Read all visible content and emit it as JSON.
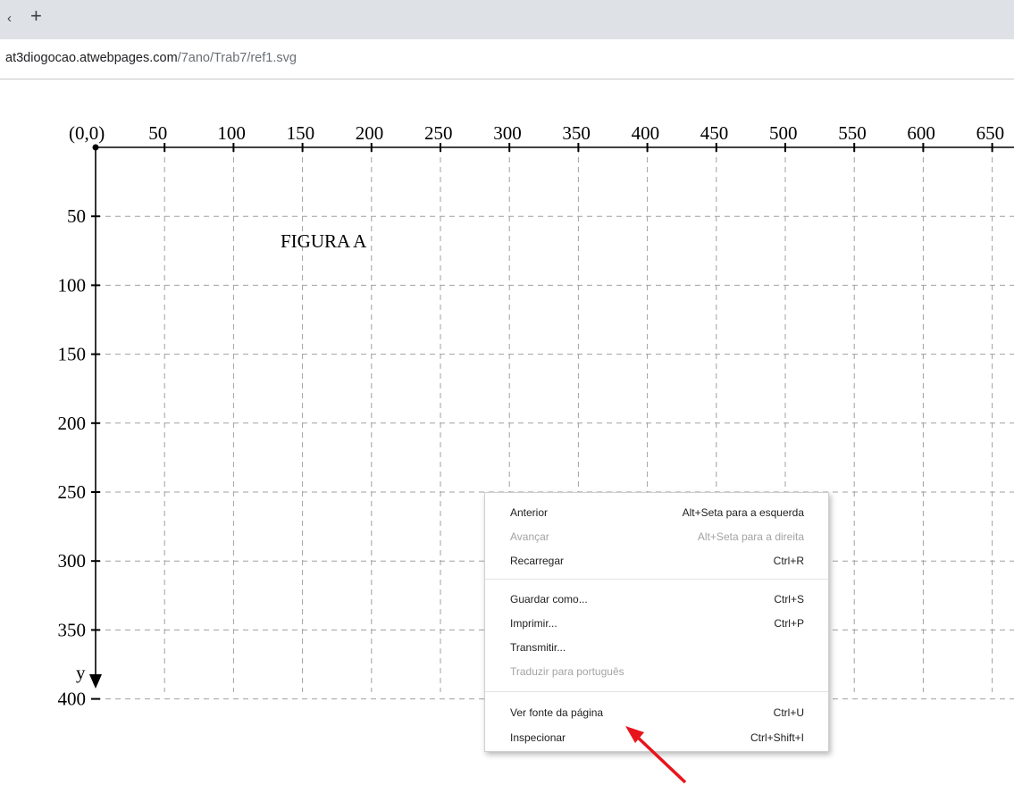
{
  "browser": {
    "tab_close_glyph": "‹",
    "new_tab_glyph": "+",
    "url_host": "at3diogocao.atwebpages.com",
    "url_path": "/7ano/Trab7/ref1.svg"
  },
  "svg_content": {
    "x_ticks": [
      "(0,0)",
      "50",
      "100",
      "150",
      "200",
      "250",
      "300",
      "350",
      "400",
      "450",
      "500",
      "550",
      "600",
      "650"
    ],
    "y_ticks": [
      "50",
      "100",
      "150",
      "200",
      "250",
      "300",
      "350",
      "400"
    ],
    "y_axis_label": "y",
    "figure_label": "FIGURA A"
  },
  "context_menu": {
    "items": [
      {
        "label": "Anterior",
        "shortcut": "Alt+Seta para a esquerda",
        "enabled": true
      },
      {
        "label": "Avançar",
        "shortcut": "Alt+Seta para a direita",
        "enabled": false
      },
      {
        "label": "Recarregar",
        "shortcut": "Ctrl+R",
        "enabled": true
      },
      {
        "label": "Guardar como...",
        "shortcut": "Ctrl+S",
        "enabled": true
      },
      {
        "label": "Imprimir...",
        "shortcut": "Ctrl+P",
        "enabled": true
      },
      {
        "label": "Transmitir...",
        "shortcut": "",
        "enabled": true
      },
      {
        "label": "Traduzir para português",
        "shortcut": "",
        "enabled": false
      },
      {
        "label": "Ver fonte da página",
        "shortcut": "Ctrl+U",
        "enabled": true
      },
      {
        "label": "Inspecionar",
        "shortcut": "Ctrl+Shift+I",
        "enabled": true
      }
    ]
  },
  "annotation_arrow_color": "#e8141c"
}
